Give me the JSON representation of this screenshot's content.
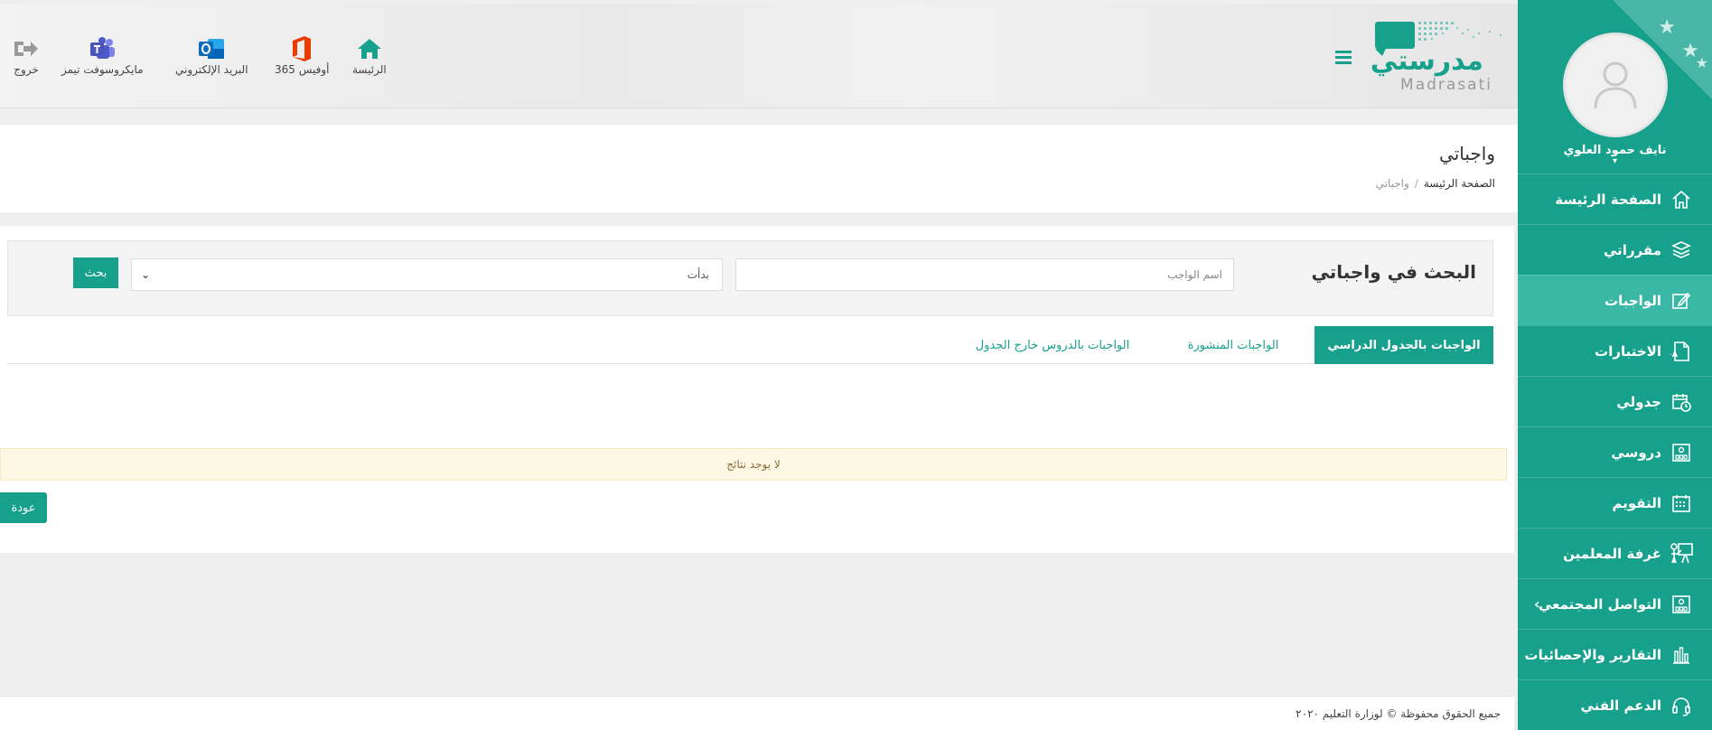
{
  "header": {
    "links": [
      {
        "id": "home",
        "label": "الرئيسة",
        "icon": "home-icon"
      },
      {
        "id": "office",
        "label": "أوفيس 365",
        "icon": "office-icon"
      },
      {
        "id": "mail",
        "label": "البريد الإلكتروني",
        "icon": "outlook-icon"
      },
      {
        "id": "teams",
        "label": "مايكروسوفت تيمز",
        "icon": "teams-icon"
      },
      {
        "id": "logout",
        "label": "خروج",
        "icon": "logout-icon"
      }
    ],
    "logo": {
      "arabic": "مدرستي",
      "latin": "Madrasati"
    },
    "menu_icon": "hamburger-icon"
  },
  "sidebar": {
    "user_name": "نايف حمود العلوي",
    "items": [
      {
        "label": "الصفحة الرئيسة",
        "icon": "home-icon",
        "active": false
      },
      {
        "label": "مقرراتي",
        "icon": "books-icon",
        "active": false
      },
      {
        "label": "الواجبات",
        "icon": "edit-icon",
        "active": true
      },
      {
        "label": "الاختبارات",
        "icon": "exam-icon",
        "active": false
      },
      {
        "label": "جدولي",
        "icon": "calendar-clock-icon",
        "active": false
      },
      {
        "label": "دروسي",
        "icon": "lessons-icon",
        "active": false
      },
      {
        "label": "التقويم",
        "icon": "calendar-icon",
        "active": false
      },
      {
        "label": "غرفة المعلمين",
        "icon": "teacher-board-icon",
        "active": false
      },
      {
        "label": "التواصل المجتمعي",
        "icon": "community-icon",
        "active": false,
        "has_submenu": true
      },
      {
        "label": "التقارير والإحصائيات",
        "icon": "bar-chart-icon",
        "active": false
      },
      {
        "label": "الدعم الفني",
        "icon": "headset-icon",
        "active": false
      }
    ]
  },
  "page": {
    "title": "واجباتي",
    "breadcrumb": {
      "home": "الصفحة الرئيسة",
      "separator": "/",
      "current": "واجباتي"
    }
  },
  "search": {
    "title": "البحث في واجباتي",
    "name_placeholder": "اسم الواجب",
    "status_value": "بدأت",
    "button_label": "بحث"
  },
  "tabs": [
    {
      "label": "الواجبات بالجدول الدراسي",
      "active": true
    },
    {
      "label": "الواجبات المنشورة",
      "active": false
    },
    {
      "label": "الواجبات بالدروس خارج الجدول",
      "active": false
    }
  ],
  "results": {
    "empty_message": "لا يوجد نتائج"
  },
  "back_button": "عودة",
  "footer": {
    "text": "جميع الحقوق محفوظة © لوزارة التعليم ٢٠٢٠"
  },
  "colors": {
    "primary": "#17a18d",
    "active_item": "#3bb7a5",
    "warning_bg": "#fcf8e3",
    "warning_text": "#8a6d3b"
  }
}
